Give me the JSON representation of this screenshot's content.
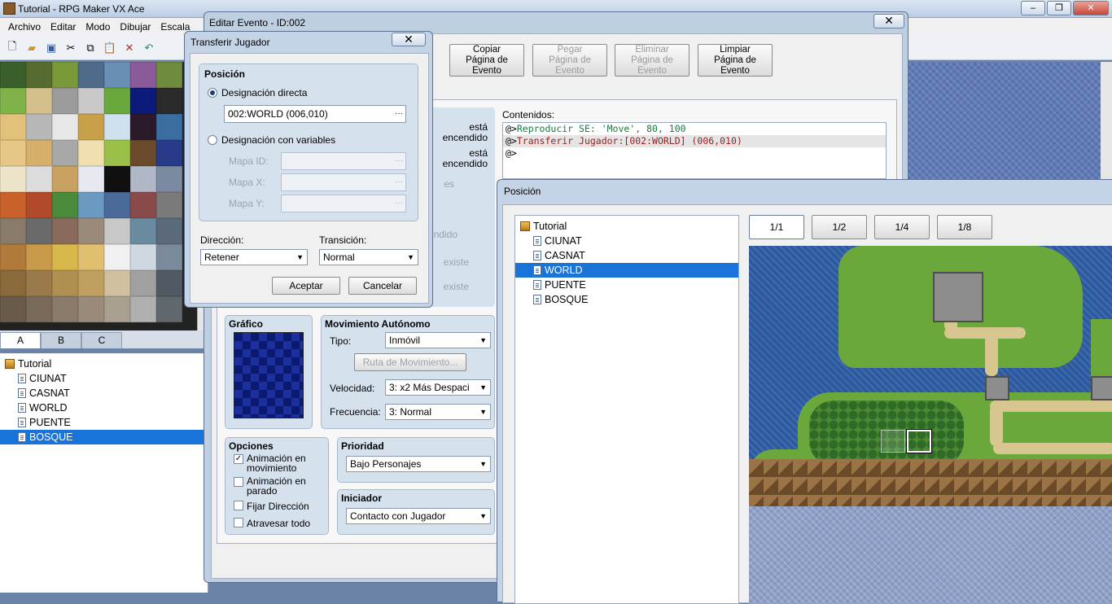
{
  "app": {
    "title": "Tutorial - RPG Maker VX Ace"
  },
  "menu": [
    "Archivo",
    "Editar",
    "Modo",
    "Dibujar",
    "Escala"
  ],
  "tileset_tabs": [
    "A",
    "B",
    "C"
  ],
  "map_tree": {
    "root": "Tutorial",
    "maps": [
      "CIUNAT",
      "CASNAT",
      "WORLD",
      "PUENTE",
      "BOSQUE"
    ],
    "selected": "BOSQUE"
  },
  "event_editor": {
    "title": "Editar Evento - ID:002",
    "page_buttons": [
      {
        "label": "Copiar\nPágina de\nEvento",
        "enabled": true
      },
      {
        "label": "Pegar\nPágina de\nEvento",
        "enabled": false
      },
      {
        "label": "Eliminar\nPágina de\nEvento",
        "enabled": false
      },
      {
        "label": "Limpiar\nPágina de\nEvento",
        "enabled": true
      }
    ],
    "conditions_fragments": [
      "está\nencendido",
      "está\nencendido",
      "es",
      "ndido",
      "existe",
      "existe"
    ],
    "contents_label": "Contenidos:",
    "contents": [
      {
        "prefix": "@>",
        "text": "Reproducir SE: 'Move', 80, 100",
        "color": "#1a7a3c"
      },
      {
        "prefix": "@>",
        "text": "Transferir Jugador:[002:WORLD] (006,010)",
        "color": "#9d1c1c"
      },
      {
        "prefix": "@>",
        "text": "",
        "color": "#000000"
      }
    ],
    "graphic_label": "Gráfico",
    "movement": {
      "title": "Movimiento Autónomo",
      "type_label": "Tipo:",
      "type_value": "Inmóvil",
      "route_button": "Ruta de Movimiento...",
      "speed_label": "Velocidad:",
      "speed_value": "3: x2 Más Despaci",
      "freq_label": "Frecuencia:",
      "freq_value": "3: Normal"
    },
    "options": {
      "title": "Opciones",
      "items": [
        {
          "label": "Animación en\nmovimiento",
          "checked": true
        },
        {
          "label": "Animación en\nparado",
          "checked": false
        },
        {
          "label": "Fijar Dirección",
          "checked": false
        },
        {
          "label": "Atravesar todo",
          "checked": false
        }
      ]
    },
    "priority": {
      "title": "Prioridad",
      "value": "Bajo Personajes"
    },
    "trigger": {
      "title": "Iniciador",
      "value": "Contacto con Jugador"
    }
  },
  "transfer_dialog": {
    "title": "Transferir Jugador",
    "group_title": "Posición",
    "direct_label": "Designación directa",
    "direct_value": "002:WORLD (006,010)",
    "variables_label": "Designación con variables",
    "map_id_label": "Mapa ID:",
    "map_x_label": "Mapa X:",
    "map_y_label": "Mapa Y:",
    "ellipsis": "···",
    "direction_label": "Dirección:",
    "direction_value": "Retener",
    "transition_label": "Transición:",
    "transition_value": "Normal",
    "ok": "Aceptar",
    "cancel": "Cancelar"
  },
  "position_window": {
    "title": "Posición",
    "tree_root": "Tutorial",
    "maps": [
      "CIUNAT",
      "CASNAT",
      "WORLD",
      "PUENTE",
      "BOSQUE"
    ],
    "selected": "WORLD",
    "zoom": [
      "1/1",
      "1/2",
      "1/4",
      "1/8"
    ],
    "zoom_active": "1/1"
  },
  "colors": {
    "selection": "#1a73d9",
    "window_frame": "#c4d3e5"
  }
}
